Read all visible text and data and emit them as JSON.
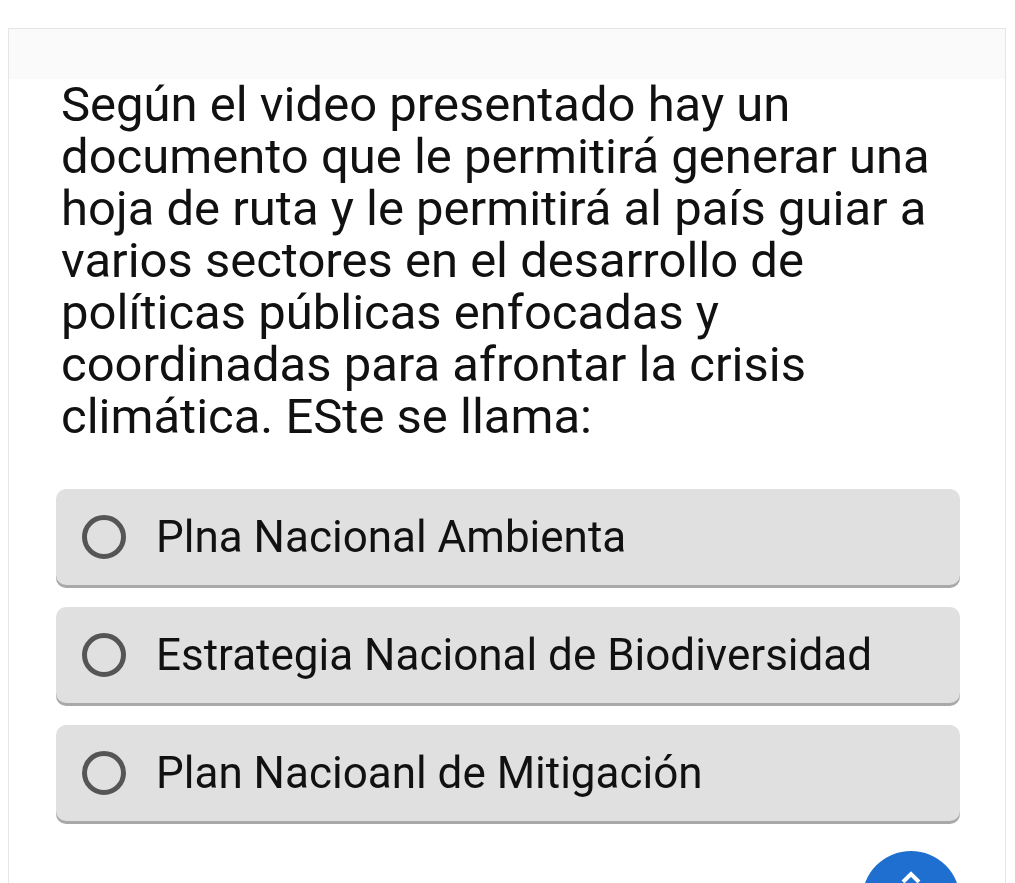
{
  "question": "Según el video presentado hay un documento que le permitirá generar una hoja de ruta y le permitirá al país guiar a varios sectores en el desarrollo de políticas públicas enfocadas y coordinadas para afrontar la crisis climática. ESte se llama:",
  "options": [
    {
      "label": "Plna Nacional Ambienta",
      "selected": false
    },
    {
      "label": "Estrategia Nacional de Biodiversidad",
      "selected": false
    },
    {
      "label": "Plan Nacioanl de Mitigación",
      "selected": false
    }
  ]
}
